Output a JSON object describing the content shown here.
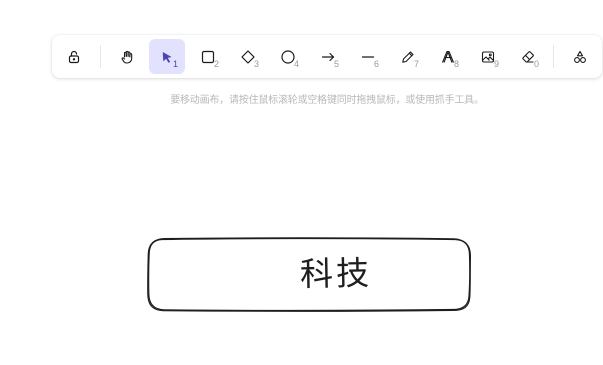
{
  "toolbar": {
    "tools": [
      {
        "name": "lock",
        "icon": "lock-open-icon",
        "key": ""
      },
      {
        "name": "hand",
        "icon": "hand-icon",
        "key": ""
      },
      {
        "name": "selection",
        "icon": "pointer-icon",
        "key": "1",
        "active": true
      },
      {
        "name": "rectangle",
        "icon": "square-icon",
        "key": "2"
      },
      {
        "name": "diamond",
        "icon": "diamond-icon",
        "key": "3"
      },
      {
        "name": "ellipse",
        "icon": "circle-icon",
        "key": "4"
      },
      {
        "name": "arrow",
        "icon": "arrow-right-icon",
        "key": "5"
      },
      {
        "name": "line",
        "icon": "line-icon",
        "key": "6"
      },
      {
        "name": "draw",
        "icon": "pencil-icon",
        "key": "7"
      },
      {
        "name": "text",
        "icon": "text-icon",
        "key": "8"
      },
      {
        "name": "image",
        "icon": "image-icon",
        "key": "9"
      },
      {
        "name": "eraser",
        "icon": "eraser-icon",
        "key": "0"
      },
      {
        "name": "library",
        "icon": "shapes-icon",
        "key": ""
      }
    ],
    "active_color": "#e3e2fe",
    "active_icon_color": "#4a47b1"
  },
  "hint": {
    "text": "要移动画布，请按住鼠标滚轮或空格键同时拖拽鼠标，或使用抓手工具。"
  },
  "canvas": {
    "element_text": "科技"
  }
}
